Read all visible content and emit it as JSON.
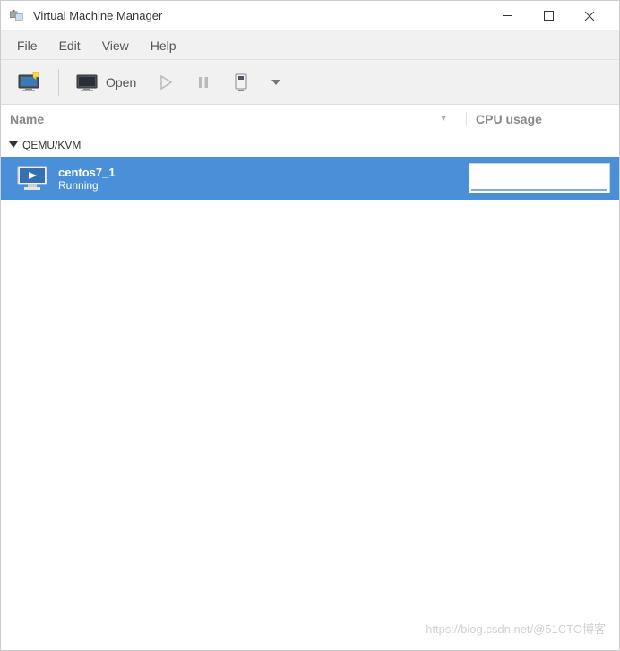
{
  "titlebar": {
    "title": "Virtual Machine Manager"
  },
  "menu": {
    "file": "File",
    "edit": "Edit",
    "view": "View",
    "help": "Help"
  },
  "toolbar": {
    "open_label": "Open"
  },
  "headers": {
    "name": "Name",
    "cpu": "CPU usage"
  },
  "groups": [
    {
      "label": "QEMU/KVM",
      "expanded": true
    }
  ],
  "vms": [
    {
      "name": "centos7_1",
      "status": "Running",
      "selected": true
    }
  ],
  "watermark": "https://blog.csdn.net/@51CTO博客"
}
